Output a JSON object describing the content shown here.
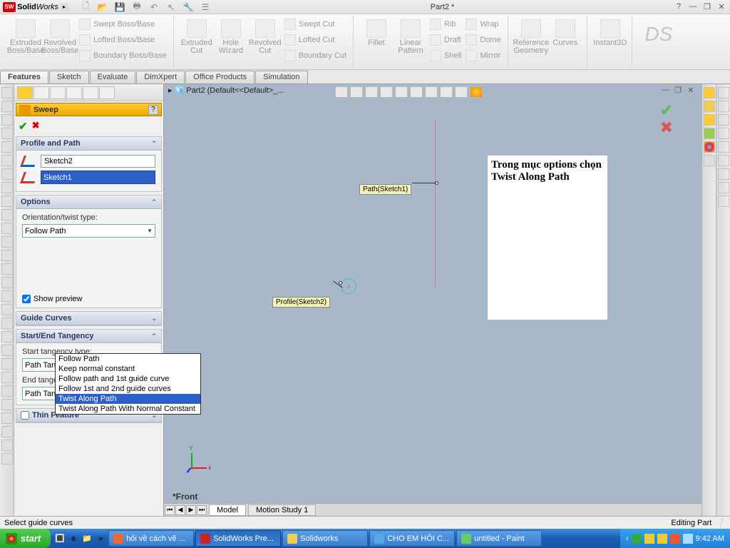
{
  "app": {
    "name_bold": "Solid",
    "name_italic": "Works",
    "doc_title": "Part2 *"
  },
  "ribbon": {
    "extruded": "Extruded Boss/Base",
    "revolved": "Revolved Boss/Base",
    "swept": "Swept Boss/Base",
    "lofted": "Lofted Boss/Base",
    "boundary": "Boundary Boss/Base",
    "extcut": "Extruded Cut",
    "hole": "Hole Wizard",
    "revcut": "Revolved Cut",
    "sweptcut": "Swept Cut",
    "loftcut": "Lofted Cut",
    "bndcut": "Boundary Cut",
    "fillet": "Fillet",
    "linpat": "Linear Pattern",
    "rib": "Rib",
    "wrap": "Wrap",
    "draft": "Draft",
    "dome": "Dome",
    "shell": "Shell",
    "mirror": "Mirror",
    "refgeo": "Reference Geometry",
    "curves": "Curves",
    "instant": "Instant3D"
  },
  "tabs": {
    "features": "Features",
    "sketch": "Sketch",
    "evaluate": "Evaluate",
    "dimxpert": "DimXpert",
    "office": "Office Products",
    "simulation": "Simulation"
  },
  "pm": {
    "title": "Sweep",
    "sec_profile": "Profile and Path",
    "profile": "Sketch2",
    "path": "Sketch1",
    "sec_options": "Options",
    "orient_lbl": "Orientation/twist type:",
    "orient_val": "Follow Path",
    "dd": {
      "i0": "Follow Path",
      "i1": "Keep normal constant",
      "i2": "Follow path and 1st guide curve",
      "i3": "Follow 1st and 2nd guide curves",
      "i4": "Twist Along Path",
      "i5": "Twist Along Path With Normal Constant"
    },
    "show_preview": "Show preview",
    "sec_guide": "Guide Curves",
    "sec_tang": "Start/End Tangency",
    "start_lbl": "Start tangency type:",
    "start_val": "Path Tangent",
    "end_lbl": "End tangency type:",
    "end_val": "Path Tangent",
    "sec_thin": "Thin Feature"
  },
  "vp": {
    "tree": "Part2  (Default<<Default>_...",
    "path_lbl": "Path(Sketch1)",
    "prof_lbl": "Profile(Sketch2)",
    "note": "Trong mục options chọn Twist Along Path",
    "front": "*Front",
    "btab_model": "Model",
    "btab_motion": "Motion Study 1"
  },
  "status": {
    "left": "Select guide curves",
    "right": "Editing Part"
  },
  "taskbar": {
    "start": "start",
    "t1": "hỏi về cách vẽ ...",
    "t2": "SolidWorks Pre...",
    "t3": "Solidworks",
    "t4": "CHO EM HỎI C...",
    "t5": "untitled - Paint",
    "clock": "9:42 AM"
  }
}
